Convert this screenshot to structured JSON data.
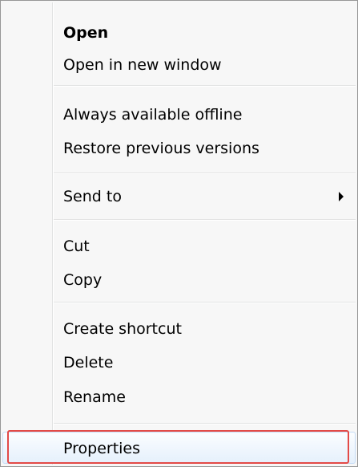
{
  "menu": {
    "items": [
      {
        "label": "Open"
      },
      {
        "label": "Open in new window"
      },
      {
        "label": "Always available offline"
      },
      {
        "label": "Restore previous versions"
      },
      {
        "label": "Send to"
      },
      {
        "label": "Cut"
      },
      {
        "label": "Copy"
      },
      {
        "label": "Create shortcut"
      },
      {
        "label": "Delete"
      },
      {
        "label": "Rename"
      },
      {
        "label": "Properties"
      }
    ]
  },
  "colors": {
    "menu_background": "#f7f7f7",
    "menu_border": "#979797",
    "separator": "#e2e3e3",
    "selected_background": "#e5f0fc",
    "highlight_outline": "#e34a47"
  },
  "icons": {
    "send_to_submenu": "chevron-right-icon"
  }
}
